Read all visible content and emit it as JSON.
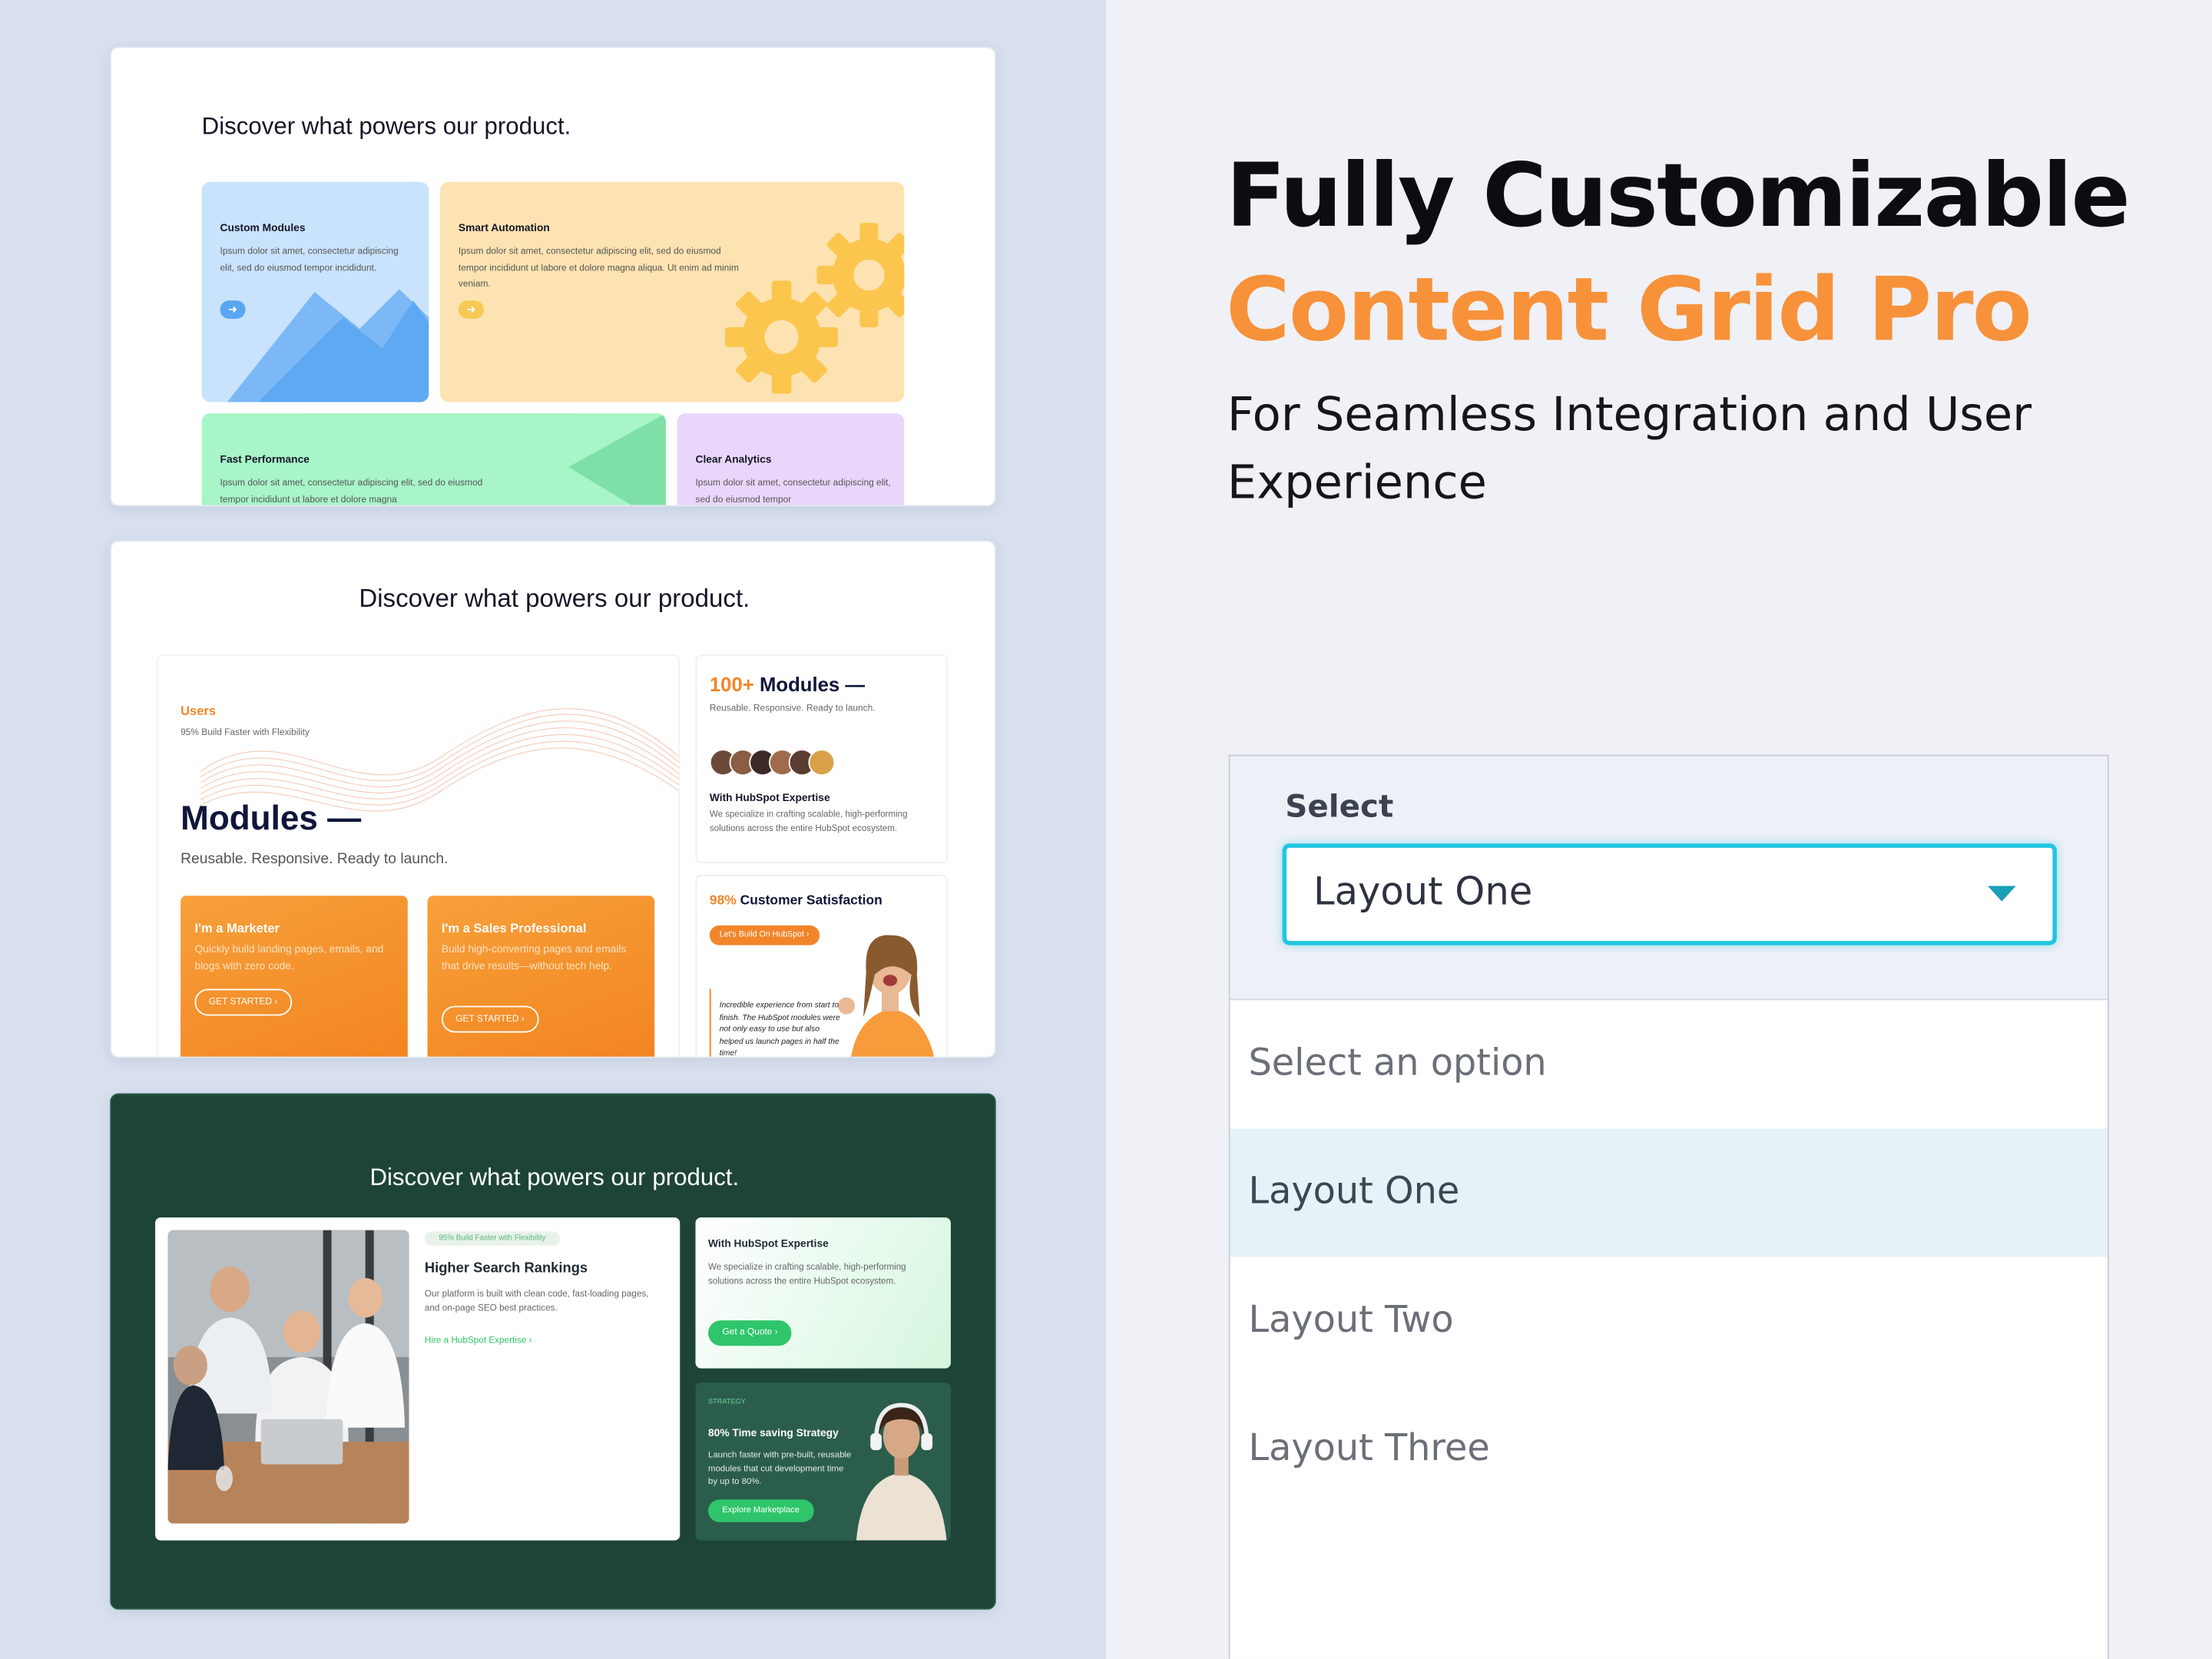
{
  "hero": {
    "line1": "Fully Customizable",
    "line2": "Content Grid Pro",
    "subtitle": "For Seamless Integration and User Experience"
  },
  "colors": {
    "accent": "#f7923a",
    "select_border": "#21c6e0",
    "highlight": "#e5f2f7",
    "dark_green": "#1d4437",
    "green_button": "#2fc56b"
  },
  "layout_one": {
    "title": "Discover what powers our product.",
    "cards": [
      {
        "title": "Custom Modules",
        "text": "Ipsum dolor sit amet, consectetur adipiscing elit, sed do eiusmod tempor incididunt.",
        "icon": "arrow-right-icon"
      },
      {
        "title": "Smart Automation",
        "text": "Ipsum dolor sit amet, consectetur adipiscing elit, sed do eiusmod tempor incididunt ut labore et dolore magna aliqua. Ut enim ad minim veniam.",
        "icon": "gear-icon"
      },
      {
        "title": "Fast Performance",
        "text": "Ipsum dolor sit amet, consectetur adipiscing elit, sed do eiusmod tempor incididunt ut labore et dolore magna"
      },
      {
        "title": "Clear Analytics",
        "text": "Ipsum dolor sit amet, consectetur adipiscing elit, sed do eiusmod tempor"
      }
    ]
  },
  "layout_two": {
    "title": "Discover what powers our product.",
    "main": {
      "label": "Users",
      "stat": "95% Build Faster with Flexibility",
      "heading": "Modules —",
      "sub": "Reusable. Responsive. Ready to launch."
    },
    "orange_cards": [
      {
        "title": "I'm a Marketer",
        "text": "Quickly build landing pages, emails, and blogs with zero code.",
        "button": "GET STARTED ›"
      },
      {
        "title": "I'm a Sales Professional",
        "text": "Build high-converting pages and emails that drive results—without tech help.",
        "button": "GET STARTED ›"
      }
    ],
    "modules_card": {
      "num": "100+",
      "heading": "Modules —",
      "sub": "Reusable. Responsive. Ready to launch.",
      "expertise_title": "With HubSpot Expertise",
      "expertise_text": "We specialize in crafting scalable, high-performing solutions across the entire HubSpot ecosystem."
    },
    "satisfaction_card": {
      "pct": "98%",
      "heading": "Customer Satisfaction",
      "button": "Let's Build On HubSpot ›",
      "quote": "Incredible experience from start to finish. The HubSpot modules were not only easy to use but also helped us launch pages in half the time!"
    }
  },
  "layout_three": {
    "title": "Discover what powers our product.",
    "main": {
      "badge": "95% Build Faster with Flexibility",
      "heading": "Higher Search Rankings",
      "text": "Our platform is built with clean code, fast-loading pages, and on-page SEO best practices.",
      "link": "Hire a HubSpot Expertise ›"
    },
    "card_top": {
      "title": "With HubSpot Expertise",
      "text": "We specialize in crafting scalable, high-performing solutions across the entire HubSpot ecosystem.",
      "button": "Get a Quote ›"
    },
    "card_bottom": {
      "label": "STRATEGY",
      "title": "80% Time saving Strategy",
      "text": "Launch faster with pre-built, reusable modules that cut development time by up to 80%.",
      "button": "Explore Marketplace"
    }
  },
  "select": {
    "label": "Select",
    "value": "Layout One",
    "icon": "chevron-down-icon",
    "options": [
      "Select an option",
      "Layout One",
      "Layout Two",
      "Layout Three"
    ],
    "highlighted_index": 1
  }
}
